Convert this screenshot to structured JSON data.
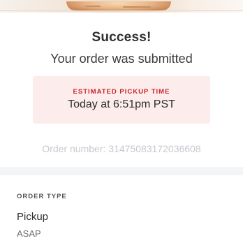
{
  "confirmation": {
    "title": "Success!",
    "subtitle": "Your order was submitted"
  },
  "pickup": {
    "label": "ESTIMATED PICKUP TIME",
    "time": "Today at 6:51pm PST"
  },
  "order": {
    "number_text": "Order number: 3147508317203660​8"
  },
  "order_type": {
    "label": "ORDER TYPE",
    "value": "Pickup",
    "timing": "ASAP"
  },
  "colors": {
    "accent": "#c7242b",
    "card_background": "#fdecec",
    "muted_text": "#c5c9cf"
  }
}
